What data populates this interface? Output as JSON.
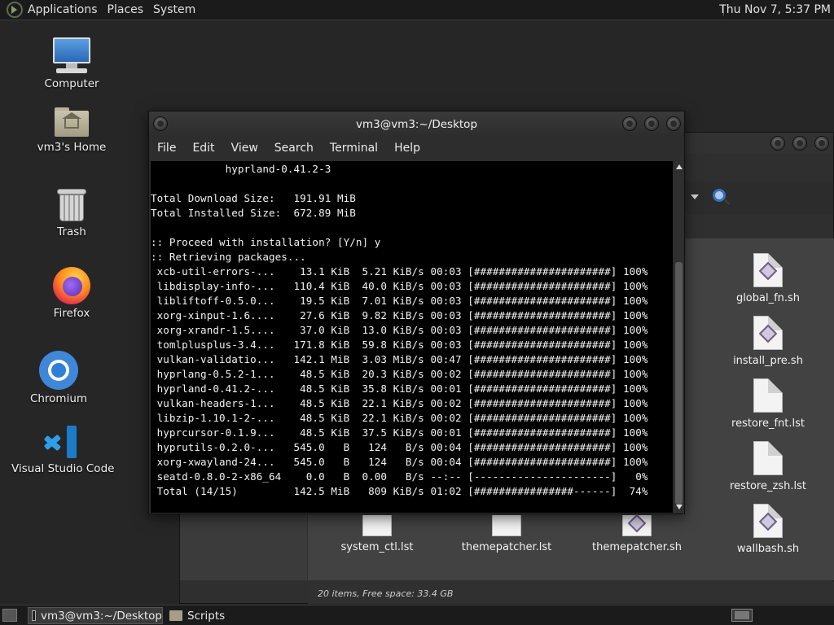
{
  "top_panel": {
    "menus": [
      "Applications",
      "Places",
      "System"
    ],
    "clock": "Thu Nov 7,  5:37 PM"
  },
  "desktop_icons": [
    {
      "label": "Computer",
      "icon": "computer-icon"
    },
    {
      "label": "vm3's Home",
      "icon": "home-folder-icon"
    },
    {
      "label": "Trash",
      "icon": "trash-icon"
    },
    {
      "label": "Firefox",
      "icon": "firefox-icon"
    },
    {
      "label": "Chromium",
      "icon": "chromium-icon"
    },
    {
      "label": "Visual Studio Code",
      "icon": "vscode-icon"
    }
  ],
  "terminal": {
    "title": "vm3@vm3:~/Desktop",
    "menus": [
      "File",
      "Edit",
      "View",
      "Search",
      "Terminal",
      "Help"
    ],
    "lines": [
      "            hyprland-0.41.2-3",
      "",
      "Total Download Size:   191.91 MiB",
      "Total Installed Size:  672.89 MiB",
      "",
      ":: Proceed with installation? [Y/n] y",
      ":: Retrieving packages...",
      " xcb-util-errors-...    13.1 KiB  5.21 KiB/s 00:03 [######################] 100%",
      " libdisplay-info-...   110.4 KiB  40.0 KiB/s 00:03 [######################] 100%",
      " libliftoff-0.5.0...    19.5 KiB  7.01 KiB/s 00:03 [######################] 100%",
      " xorg-xinput-1.6....    27.6 KiB  9.82 KiB/s 00:03 [######################] 100%",
      " xorg-xrandr-1.5....    37.0 KiB  13.0 KiB/s 00:03 [######################] 100%",
      " tomlplusplus-3.4...   171.8 KiB  59.8 KiB/s 00:03 [######################] 100%",
      " vulkan-validatio...   142.1 MiB  3.03 MiB/s 00:47 [######################] 100%",
      " hyprlang-0.5.2-1...    48.5 KiB  20.3 KiB/s 00:02 [######################] 100%",
      " hyprland-0.41.2-...    48.5 KiB  35.8 KiB/s 00:01 [######################] 100%",
      " vulkan-headers-1...    48.5 KiB  22.1 KiB/s 00:02 [######################] 100%",
      " libzip-1.10.1-2-...    48.5 KiB  22.1 KiB/s 00:02 [######################] 100%",
      " hyprcursor-0.1.9...    48.5 KiB  37.5 KiB/s 00:01 [######################] 100%",
      " hyprutils-0.2.0-...   545.0   B   124   B/s 00:04 [######################] 100%",
      " xorg-xwayland-24...   545.0   B   124   B/s 00:04 [######################] 100%",
      " seatd-0.8.0-2-x86_64    0.0   B  0.00   B/s --:-- [----------------------]   0%",
      " Total (14/15)         142.5 MiB   809 KiB/s 01:02 [################------]  74%"
    ]
  },
  "file_manager": {
    "files_right": [
      {
        "name": "global_fn.sh",
        "kind": "script"
      },
      {
        "name": "install_pre.sh",
        "kind": "script"
      },
      {
        "name": "restore_fnt.lst",
        "kind": "text"
      },
      {
        "name": "restore_zsh.lst",
        "kind": "text"
      }
    ],
    "files_bottom": [
      {
        "name": "system_ctl.lst",
        "kind": "text"
      },
      {
        "name": "themepatcher.lst",
        "kind": "text"
      },
      {
        "name": "themepatcher.sh",
        "kind": "script"
      },
      {
        "name": "wallbash.sh",
        "kind": "script"
      }
    ],
    "status": "20 items, Free space: 33.4 GB"
  },
  "taskbar": {
    "tasks": [
      "vm3@vm3:~/Desktop",
      "Scripts"
    ]
  },
  "colors": {
    "desktop_bg": "#262626",
    "terminal_bg": "#000000",
    "panel_bg": "#1b1b1b"
  }
}
